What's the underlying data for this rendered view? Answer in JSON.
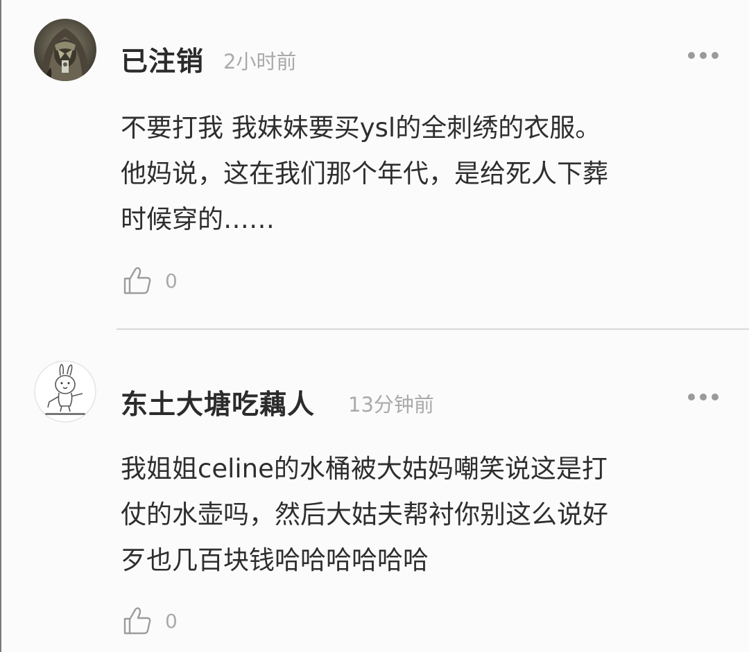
{
  "comments": [
    {
      "username": "已注销",
      "time": "2小时前",
      "avatar_icon": "hooded-figure-avatar",
      "body_lines": [
        "不要打我 我妹妹要买ysl的全刺绣的衣服。",
        "他妈说，这在我们那个年代，是给死人下葬",
        "时候穿的……"
      ],
      "likes": "0"
    },
    {
      "username": "东土大塘吃藕人",
      "time": "13分钟前",
      "avatar_icon": "rabbit-doodle-avatar",
      "body_lines": [
        "我姐姐celine的水桶被大姑妈嘲笑说这是打",
        "仗的水壶吗，然后大姑夫帮衬你别这么说好",
        "歹也几百块钱哈哈哈哈哈哈"
      ],
      "likes": "0"
    }
  ],
  "colors": {
    "background": "#fcfbfc",
    "username": "#2b2b2b",
    "timestamp": "#aaaaaa",
    "body": "#2e2e2e",
    "divider": "#d8d8d8"
  }
}
